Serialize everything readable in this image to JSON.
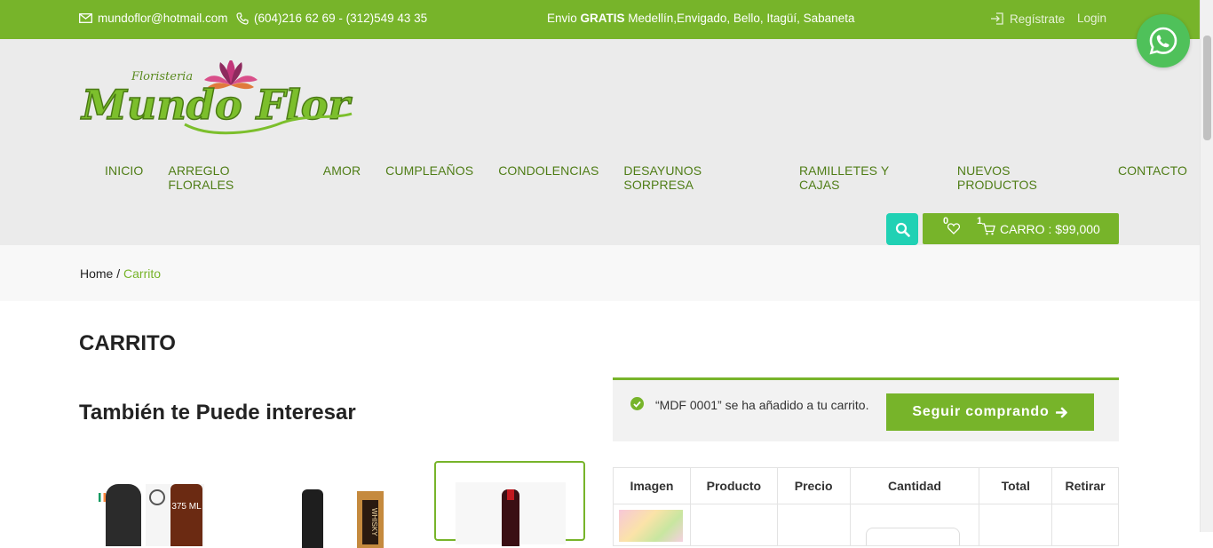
{
  "topbar": {
    "email": "mundoflor@hotmail.com",
    "phones": "(604)216 62 69 - (312)549 43 35",
    "shipping_prefix": "Envio ",
    "shipping_bold": "GRATIS",
    "shipping_suffix": " Medellín,Envigado, Bello, Itagüí, Sabaneta",
    "register": "Regístrate",
    "login": "Login"
  },
  "logo": {
    "small_text": "Floristeria",
    "main_text": "Mundo Flor"
  },
  "nav": [
    "INICIO",
    "ARREGLO FLORALES",
    "AMOR",
    "CUMPLEAÑOS",
    "CONDOLENCIAS",
    "DESAYUNOS SORPRESA",
    "RAMILLETES Y CAJAS",
    "NUEVOS PRODUCTOS",
    "CONTACTO"
  ],
  "wishlist_count": "0",
  "cart": {
    "count": "1",
    "label": "CARRO : $99,000"
  },
  "breadcrumb": {
    "home": "Home",
    "separator": " / ",
    "current": "Carrito"
  },
  "page_title": "CARRITO",
  "related_title": "También te Puede interesar",
  "notice": {
    "message": "“MDF 0001” se ha añadido a tu carrito.",
    "button": "Seguir comprando"
  },
  "table_headers": [
    "Imagen",
    "Producto",
    "Precio",
    "Cantidad",
    "Total",
    "Retirar"
  ],
  "products": [
    {
      "badge": "375 ML"
    },
    {
      "badge": "WHISKY"
    },
    {
      "badge": ""
    }
  ],
  "colors": {
    "brand_green": "#77b42a",
    "nav_text": "#4f7d16",
    "search_teal": "#20d1b4",
    "whatsapp": "#4fc15a"
  }
}
